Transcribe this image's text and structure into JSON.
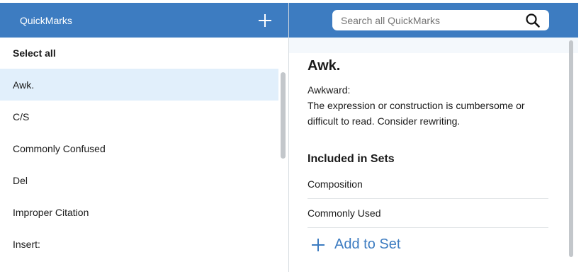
{
  "left": {
    "title": "QuickMarks",
    "select_all": "Select all",
    "items": [
      {
        "label": "Awk."
      },
      {
        "label": "C/S"
      },
      {
        "label": "Commonly Confused"
      },
      {
        "label": "Del"
      },
      {
        "label": "Improper Citation"
      },
      {
        "label": "Insert:"
      }
    ]
  },
  "right": {
    "search_placeholder": "Search all QuickMarks",
    "detail": {
      "title": "Awk.",
      "label": "Awkward:",
      "description": "The expression or construction is cumbersome or difficult to read. Consider rewriting."
    },
    "sets_heading": "Included in Sets",
    "sets": [
      {
        "label": "Composition"
      },
      {
        "label": "Commonly Used"
      }
    ],
    "add_to_set": "Add to Set"
  },
  "colors": {
    "header_blue": "#3d7cc1",
    "selected_bg": "#e1effb"
  }
}
